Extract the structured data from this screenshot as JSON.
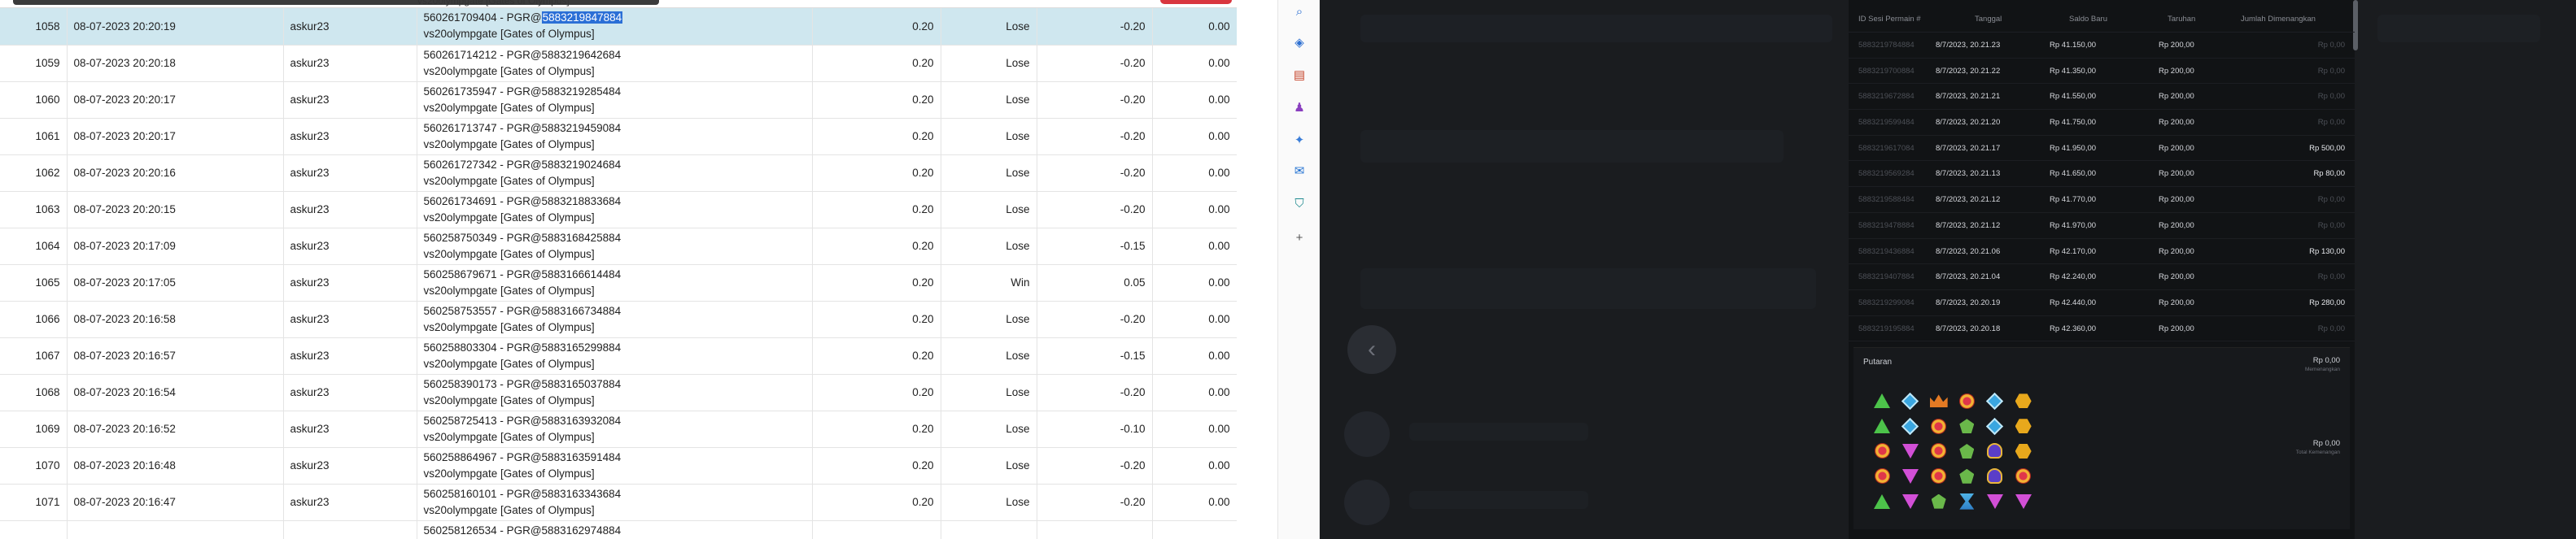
{
  "history": {
    "cut_row_text": "vs20olympgate [Gates of Olympus]",
    "rows": [
      {
        "no": "1058",
        "date": "08-07-2023 20:20:19",
        "user": "askur23",
        "desc_pre": "560261709404 - PGR@",
        "desc_hl": "5883219847884",
        "desc_post": "",
        "game": "vs20olympgate [Gates of Olympus]",
        "stake": "0.20",
        "result": "Lose",
        "win": "-0.20",
        "balance": "0.00",
        "selected": true
      },
      {
        "no": "1059",
        "date": "08-07-2023 20:20:18",
        "user": "askur23",
        "desc_pre": "560261714212 - PGR@5883219642684",
        "desc_hl": "",
        "desc_post": "",
        "game": "vs20olympgate [Gates of Olympus]",
        "stake": "0.20",
        "result": "Lose",
        "win": "-0.20",
        "balance": "0.00",
        "selected": false
      },
      {
        "no": "1060",
        "date": "08-07-2023 20:20:17",
        "user": "askur23",
        "desc_pre": "560261735947 - PGR@5883219285484",
        "desc_hl": "",
        "desc_post": "",
        "game": "vs20olympgate [Gates of Olympus]",
        "stake": "0.20",
        "result": "Lose",
        "win": "-0.20",
        "balance": "0.00",
        "selected": false
      },
      {
        "no": "1061",
        "date": "08-07-2023 20:20:17",
        "user": "askur23",
        "desc_pre": "560261713747 - PGR@5883219459084",
        "desc_hl": "",
        "desc_post": "",
        "game": "vs20olympgate [Gates of Olympus]",
        "stake": "0.20",
        "result": "Lose",
        "win": "-0.20",
        "balance": "0.00",
        "selected": false
      },
      {
        "no": "1062",
        "date": "08-07-2023 20:20:16",
        "user": "askur23",
        "desc_pre": "560261727342 - PGR@5883219024684",
        "desc_hl": "",
        "desc_post": "",
        "game": "vs20olympgate [Gates of Olympus]",
        "stake": "0.20",
        "result": "Lose",
        "win": "-0.20",
        "balance": "0.00",
        "selected": false
      },
      {
        "no": "1063",
        "date": "08-07-2023 20:20:15",
        "user": "askur23",
        "desc_pre": "560261734691 - PGR@5883218833684",
        "desc_hl": "",
        "desc_post": "",
        "game": "vs20olympgate [Gates of Olympus]",
        "stake": "0.20",
        "result": "Lose",
        "win": "-0.20",
        "balance": "0.00",
        "selected": false
      },
      {
        "no": "1064",
        "date": "08-07-2023 20:17:09",
        "user": "askur23",
        "desc_pre": "560258750349 - PGR@5883168425884",
        "desc_hl": "",
        "desc_post": "",
        "game": "vs20olympgate [Gates of Olympus]",
        "stake": "0.20",
        "result": "Lose",
        "win": "-0.15",
        "balance": "0.00",
        "selected": false
      },
      {
        "no": "1065",
        "date": "08-07-2023 20:17:05",
        "user": "askur23",
        "desc_pre": "560258679671 - PGR@5883166614484",
        "desc_hl": "",
        "desc_post": "",
        "game": "vs20olympgate [Gates of Olympus]",
        "stake": "0.20",
        "result": "Win",
        "win": "0.05",
        "balance": "0.00",
        "selected": false
      },
      {
        "no": "1066",
        "date": "08-07-2023 20:16:58",
        "user": "askur23",
        "desc_pre": "560258753557 - PGR@5883166734884",
        "desc_hl": "",
        "desc_post": "",
        "game": "vs20olympgate [Gates of Olympus]",
        "stake": "0.20",
        "result": "Lose",
        "win": "-0.20",
        "balance": "0.00",
        "selected": false
      },
      {
        "no": "1067",
        "date": "08-07-2023 20:16:57",
        "user": "askur23",
        "desc_pre": "560258803304 - PGR@5883165299884",
        "desc_hl": "",
        "desc_post": "",
        "game": "vs20olympgate [Gates of Olympus]",
        "stake": "0.20",
        "result": "Lose",
        "win": "-0.15",
        "balance": "0.00",
        "selected": false
      },
      {
        "no": "1068",
        "date": "08-07-2023 20:16:54",
        "user": "askur23",
        "desc_pre": "560258390173 - PGR@5883165037884",
        "desc_hl": "",
        "desc_post": "",
        "game": "vs20olympgate [Gates of Olympus]",
        "stake": "0.20",
        "result": "Lose",
        "win": "-0.20",
        "balance": "0.00",
        "selected": false
      },
      {
        "no": "1069",
        "date": "08-07-2023 20:16:52",
        "user": "askur23",
        "desc_pre": "560258725413 - PGR@5883163932084",
        "desc_hl": "",
        "desc_post": "",
        "game": "vs20olympgate [Gates of Olympus]",
        "stake": "0.20",
        "result": "Lose",
        "win": "-0.10",
        "balance": "0.00",
        "selected": false
      },
      {
        "no": "1070",
        "date": "08-07-2023 20:16:48",
        "user": "askur23",
        "desc_pre": "560258864967 - PGR@5883163591484",
        "desc_hl": "",
        "desc_post": "",
        "game": "vs20olympgate [Gates of Olympus]",
        "stake": "0.20",
        "result": "Lose",
        "win": "-0.20",
        "balance": "0.00",
        "selected": false
      },
      {
        "no": "1071",
        "date": "08-07-2023 20:16:47",
        "user": "askur23",
        "desc_pre": "560258160101 - PGR@5883163343684",
        "desc_hl": "",
        "desc_post": "",
        "game": "vs20olympgate [Gates of Olympus]",
        "stake": "0.20",
        "result": "Lose",
        "win": "-0.20",
        "balance": "0.00",
        "selected": false
      }
    ],
    "cut_bottom_text": "560258126534 - PGR@5883162974884"
  },
  "sidebar": {
    "icons": [
      {
        "name": "search-icon",
        "glyph": "⌕",
        "color": "#2c6fd1"
      },
      {
        "name": "tag-icon",
        "glyph": "◈",
        "color": "#2c6fd1"
      },
      {
        "name": "briefcase-icon",
        "glyph": "▤",
        "color": "#c6452c"
      },
      {
        "name": "people-icon",
        "glyph": "♟",
        "color": "#8a3fbf"
      },
      {
        "name": "copilot-icon",
        "glyph": "✦",
        "color": "#3b7ed8"
      },
      {
        "name": "outlook-icon",
        "glyph": "✉",
        "color": "#1e6fd1"
      },
      {
        "name": "shopping-icon",
        "glyph": "⛉",
        "color": "#1f8a8f"
      },
      {
        "name": "add-icon",
        "glyph": "+",
        "color": "#555555"
      }
    ]
  },
  "panel": {
    "headers": [
      "ID Sesi Permain #",
      "Tanggal",
      "Saldo Baru",
      "Taruhan",
      "Jumlah Dimenangkan"
    ],
    "rows": [
      {
        "id": "5883219784884",
        "date": "8/7/2023, 20.21.23",
        "bal": "Rp 41.150,00",
        "bet": "Rp 200,00",
        "win": "Rp 0,00"
      },
      {
        "id": "5883219700884",
        "date": "8/7/2023, 20.21.22",
        "bal": "Rp 41.350,00",
        "bet": "Rp 200,00",
        "win": "Rp 0,00"
      },
      {
        "id": "5883219672884",
        "date": "8/7/2023, 20.21.21",
        "bal": "Rp 41.550,00",
        "bet": "Rp 200,00",
        "win": "Rp 0,00"
      },
      {
        "id": "5883219599484",
        "date": "8/7/2023, 20.21.20",
        "bal": "Rp 41.750,00",
        "bet": "Rp 200,00",
        "win": "Rp 0,00"
      },
      {
        "id": "5883219617084",
        "date": "8/7/2023, 20.21.17",
        "bal": "Rp 41.950,00",
        "bet": "Rp 200,00",
        "win": "Rp 500,00"
      },
      {
        "id": "5883219569284",
        "date": "8/7/2023, 20.21.13",
        "bal": "Rp 41.650,00",
        "bet": "Rp 200,00",
        "win": "Rp 80,00"
      },
      {
        "id": "5883219588484",
        "date": "8/7/2023, 20.21.12",
        "bal": "Rp 41.770,00",
        "bet": "Rp 200,00",
        "win": "Rp 0,00"
      },
      {
        "id": "5883219478884",
        "date": "8/7/2023, 20.21.12",
        "bal": "Rp 41.970,00",
        "bet": "Rp 200,00",
        "win": "Rp 0,00"
      },
      {
        "id": "5883219436884",
        "date": "8/7/2023, 20.21.06",
        "bal": "Rp 42.170,00",
        "bet": "Rp 200,00",
        "win": "Rp 130,00"
      },
      {
        "id": "5883219407884",
        "date": "8/7/2023, 20.21.04",
        "bal": "Rp 42.240,00",
        "bet": "Rp 200,00",
        "win": "Rp 0,00"
      },
      {
        "id": "5883219299084",
        "date": "8/7/2023, 20.20.19",
        "bal": "Rp 42.440,00",
        "bet": "Rp 200,00",
        "win": "Rp 280,00"
      },
      {
        "id": "5883219195884",
        "date": "8/7/2023, 20.20.18",
        "bal": "Rp 42.360,00",
        "bet": "Rp 200,00",
        "win": "Rp 0,00"
      }
    ],
    "round_title": "Putaran",
    "round_amount": "Rp 0,00",
    "round_label": "Memenangkan",
    "total_amount": "Rp 0,00",
    "total_label": "Total Kemenangan",
    "grid": [
      [
        "tri",
        "dia",
        "crown",
        "ring",
        "dia",
        "hex"
      ],
      [
        "tri",
        "dia",
        "ring",
        "gem",
        "dia",
        "hex"
      ],
      [
        "ring",
        "dtri",
        "ring",
        "gem",
        "cup",
        "hex"
      ],
      [
        "ring",
        "dtri",
        "ring",
        "gem",
        "cup",
        "ring"
      ],
      [
        "tri",
        "dtri",
        "gem",
        "hour",
        "dtri",
        "dtri"
      ]
    ]
  }
}
